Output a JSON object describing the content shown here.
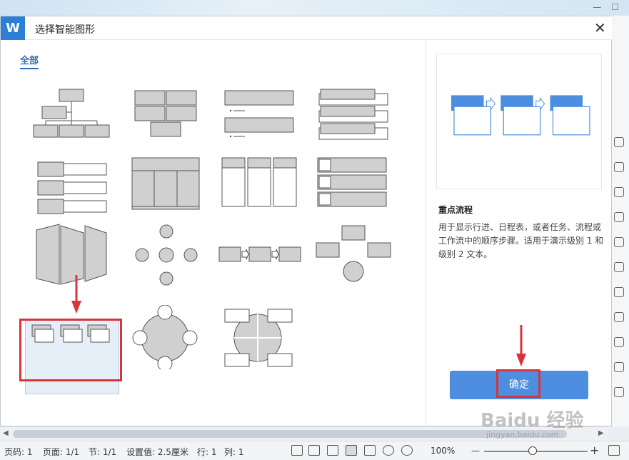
{
  "dialog": {
    "title": "选择智能图形",
    "tab_all": "全部",
    "selected_template": "重点流程",
    "description": "用于显示行进、日程表，或者任务、流程或工作流中的顺序步骤。适用于演示级别 1 和级别 2 文本。",
    "ok_label": "确定",
    "close_icon": "close-icon"
  },
  "statusbar": {
    "page_code": "页码: 1",
    "pages": "页面: 1/1",
    "section": "节: 1/1",
    "setting": "设置值: 2.5厘米",
    "row": "行: 1",
    "col": "列: 1",
    "zoom": "100%"
  },
  "watermark": {
    "main": "Baidu 经验",
    "sub": "jingyan.baidu.com"
  },
  "colors": {
    "accent": "#4d8ee0",
    "highlight": "#d9343a",
    "logo": "#2b7fd4"
  }
}
